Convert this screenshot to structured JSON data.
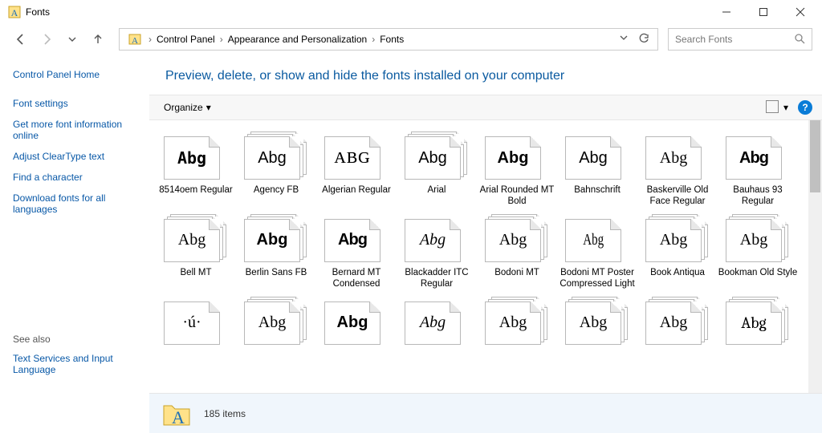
{
  "window": {
    "title": "Fonts"
  },
  "nav": {
    "breadcrumb": [
      "Control Panel",
      "Appearance and Personalization",
      "Fonts"
    ],
    "search_placeholder": "Search Fonts"
  },
  "sidebar": {
    "home": "Control Panel Home",
    "links": [
      "Font settings",
      "Get more font information online",
      "Adjust ClearType text",
      "Find a character",
      "Download fonts for all languages"
    ],
    "seealso_title": "See also",
    "seealso": [
      "Text Services and Input Language"
    ]
  },
  "main": {
    "heading": "Preview, delete, or show and hide the fonts installed on your computer",
    "organize_label": "Organize",
    "fonts": [
      {
        "label": "8514oem Regular",
        "sample": "Abg",
        "stack": false,
        "glyph": "g0"
      },
      {
        "label": "Agency FB",
        "sample": "Abg",
        "stack": true,
        "glyph": "g1"
      },
      {
        "label": "Algerian Regular",
        "sample": "ABG",
        "stack": false,
        "glyph": "g2"
      },
      {
        "label": "Arial",
        "sample": "Abg",
        "stack": true,
        "glyph": "g3"
      },
      {
        "label": "Arial Rounded MT Bold",
        "sample": "Abg",
        "stack": false,
        "glyph": "g4"
      },
      {
        "label": "Bahnschrift",
        "sample": "Abg",
        "stack": false,
        "glyph": "g5"
      },
      {
        "label": "Baskerville Old Face Regular",
        "sample": "Abg",
        "stack": false,
        "glyph": "g6"
      },
      {
        "label": "Bauhaus 93 Regular",
        "sample": "Abg",
        "stack": false,
        "glyph": "g7"
      },
      {
        "label": "Bell MT",
        "sample": "Abg",
        "stack": true,
        "glyph": "g8"
      },
      {
        "label": "Berlin Sans FB",
        "sample": "Abg",
        "stack": true,
        "glyph": "g9"
      },
      {
        "label": "Bernard MT Condensed",
        "sample": "Abg",
        "stack": false,
        "glyph": "g10"
      },
      {
        "label": "Blackadder ITC Regular",
        "sample": "Abg",
        "stack": false,
        "glyph": "g11"
      },
      {
        "label": "Bodoni MT",
        "sample": "Abg",
        "stack": true,
        "glyph": "g12"
      },
      {
        "label": "Bodoni MT Poster Compressed Light",
        "sample": "Abg",
        "stack": false,
        "glyph": "g13"
      },
      {
        "label": "Book Antiqua",
        "sample": "Abg",
        "stack": true,
        "glyph": "g14"
      },
      {
        "label": "Bookman Old Style",
        "sample": "Abg",
        "stack": true,
        "glyph": "g15"
      },
      {
        "label": "",
        "sample": "·ú·",
        "stack": false,
        "glyph": "g16"
      },
      {
        "label": "",
        "sample": "Abg",
        "stack": true,
        "glyph": "g17"
      },
      {
        "label": "",
        "sample": "Abg",
        "stack": false,
        "glyph": "g18"
      },
      {
        "label": "",
        "sample": "Abg",
        "stack": false,
        "glyph": "g19"
      },
      {
        "label": "",
        "sample": "Abg",
        "stack": true,
        "glyph": "g20"
      },
      {
        "label": "",
        "sample": "Abg",
        "stack": true,
        "glyph": "g21"
      },
      {
        "label": "",
        "sample": "Abg",
        "stack": true,
        "glyph": "g22"
      },
      {
        "label": "",
        "sample": "Abg",
        "stack": true,
        "glyph": "g23"
      }
    ]
  },
  "status": {
    "items_label": "185 items"
  }
}
